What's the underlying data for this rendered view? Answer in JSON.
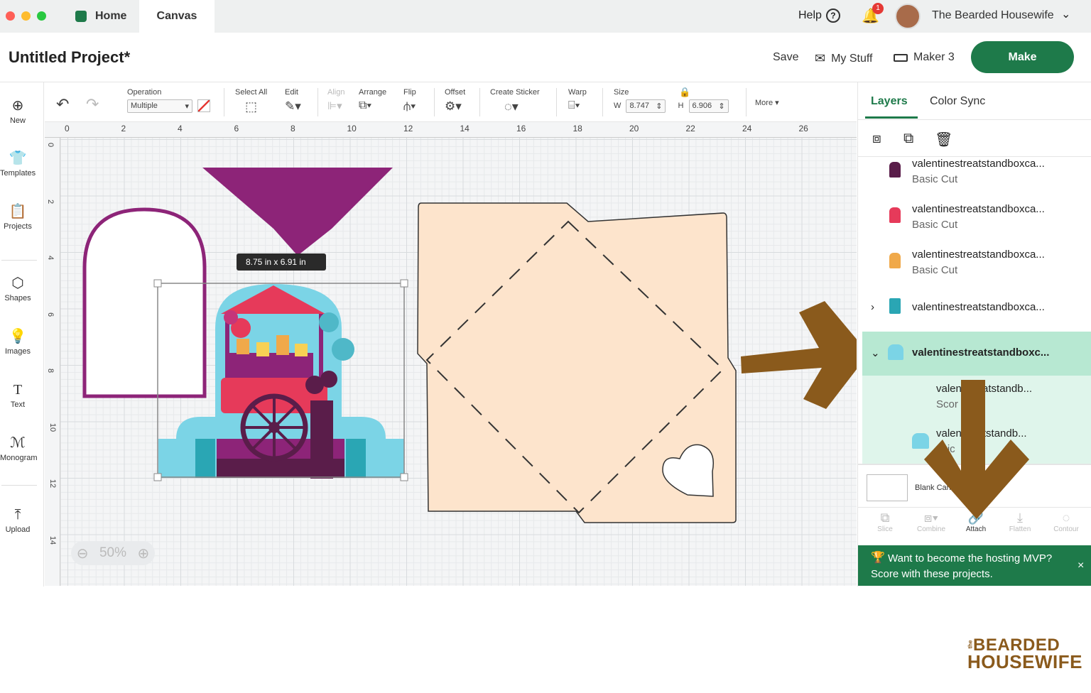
{
  "window": {
    "tabs": [
      {
        "label": "Home"
      },
      {
        "label": "Canvas"
      }
    ],
    "help": "Help",
    "notif_count": "1",
    "user": "The Bearded Housewife"
  },
  "header": {
    "title": "Untitled Project*",
    "save": "Save",
    "my_stuff": "My Stuff",
    "machine": "Maker 3",
    "make": "Make"
  },
  "rail": [
    {
      "label": "New",
      "icon": "⊕"
    },
    {
      "label": "Templates",
      "icon": "👕"
    },
    {
      "label": "Projects",
      "icon": "📋"
    },
    {
      "label": "Shapes",
      "icon": "⬡"
    },
    {
      "label": "Images",
      "icon": "💡"
    },
    {
      "label": "Text",
      "icon": "T"
    },
    {
      "label": "Monogram",
      "icon": "ℳ"
    },
    {
      "label": "Upload",
      "icon": "⤒"
    }
  ],
  "toolbar": {
    "operation_label": "Operation",
    "operation_value": "Multiple",
    "select_all": "Select All",
    "edit": "Edit",
    "align": "Align",
    "arrange": "Arrange",
    "flip": "Flip",
    "offset": "Offset",
    "create_sticker": "Create Sticker",
    "warp": "Warp",
    "size": "Size",
    "w_label": "W",
    "w_value": "8.747",
    "h_label": "H",
    "h_value": "6.906",
    "more": "More ▾"
  },
  "ruler": {
    "top": [
      "0",
      "2",
      "4",
      "6",
      "8",
      "10",
      "12",
      "14",
      "16",
      "18",
      "20",
      "22",
      "24",
      "26"
    ],
    "left": [
      "0",
      "2",
      "4",
      "6",
      "8",
      "10",
      "12",
      "14"
    ]
  },
  "canvas": {
    "size_tooltip": "8.75  in x 6.91  in",
    "zoom": "50%"
  },
  "panel": {
    "tabs": [
      "Layers",
      "Color Sync"
    ],
    "layers": [
      {
        "name": "valentinestreatstandboxca...",
        "sub": "Basic Cut"
      },
      {
        "name": "valentinestreatstandboxca...",
        "sub": "Basic Cut"
      },
      {
        "name": "valentinestreatstandboxca...",
        "sub": "Basic Cut"
      },
      {
        "name": "valentinestreatstandboxca...",
        "sub": ""
      },
      {
        "name": "valentinestreatstandboxc...",
        "sub": ""
      },
      {
        "name": "valen   streatstandb...",
        "sub": "Scor"
      },
      {
        "name": "valen   treatstandb...",
        "sub": "asic"
      }
    ],
    "blank_canvas": "Blank Canv",
    "tools": [
      "Slice",
      "Combine",
      "Attach",
      "Flatten",
      "Contour"
    ],
    "promo_line1": "Want to become the hosting MVP?",
    "promo_line2": "Score with these projects.",
    "promo_close": "×"
  },
  "logo": {
    "line1": "BEARDED",
    "line2": "HOUSEWIFE",
    "prefix": "the"
  },
  "colors": {
    "accent": "#1e7a4a",
    "arrow": "#8a5a1c",
    "purple": "#8d2478",
    "peach": "#fde4cc",
    "highlight": "#c8ecdb"
  }
}
